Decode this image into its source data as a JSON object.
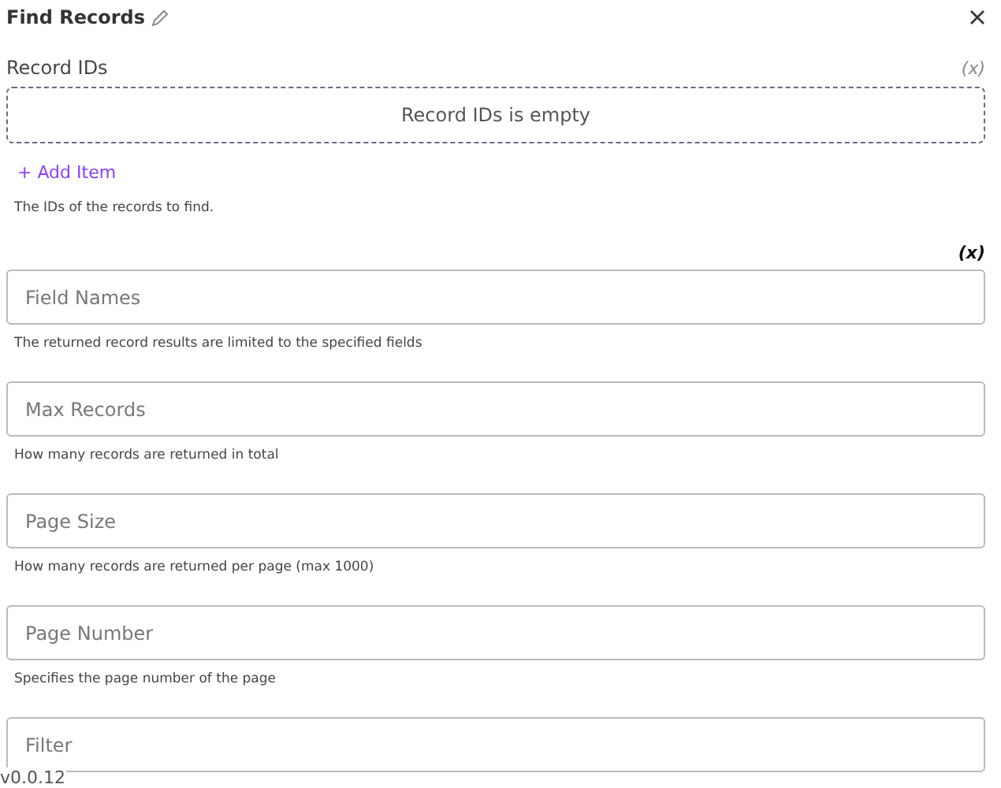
{
  "title": "Find Records",
  "record_ids": {
    "label": "Record IDs",
    "variable_toggle": "(x)",
    "empty_text": "Record IDs is empty",
    "add_label": "+ Add Item",
    "description": "The IDs of the records to find."
  },
  "variable_toggle": "(x)",
  "fields": [
    {
      "placeholder": "Field Names",
      "description": "The returned record results are limited to the specified fields"
    },
    {
      "placeholder": "Max Records",
      "description": "How many records are returned in total"
    },
    {
      "placeholder": "Page Size",
      "description": "How many records are returned per page (max 1000)"
    },
    {
      "placeholder": "Page Number",
      "description": "Specifies the page number of the page"
    },
    {
      "placeholder": "Filter"
    }
  ],
  "version": "v0.0.12"
}
